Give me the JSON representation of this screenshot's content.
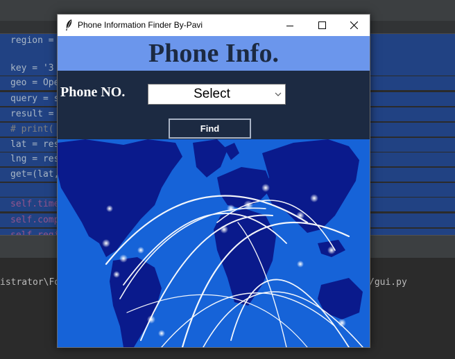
{
  "ide": {
    "code_lines": [
      "region =",
      "",
      "key = '3",
      "geo = Ope",
      "query = s",
      "result =",
      "# print(",
      "lat = res",
      "lng = res",
      "get=(lat,",
      "",
      "self.time",
      "self.comp",
      "self.regi"
    ],
    "terminal_left": "istrator\\Fo",
    "terminal_right": "/gui.py"
  },
  "window": {
    "title": "Phone Information Finder By-Pavi",
    "icons": {
      "app": "feather-icon",
      "minimize": "minimize-icon",
      "maximize": "maximize-icon",
      "close": "close-icon"
    }
  },
  "header": {
    "title": "Phone Info."
  },
  "form": {
    "phone_label": "Phone NO.",
    "select_value": "Select",
    "find_label": "Find"
  },
  "colors": {
    "header_bg": "#6b96ec",
    "panel_bg": "#1c2a42",
    "map_bg": "#1663d8",
    "continents": "#0a1a8c"
  }
}
